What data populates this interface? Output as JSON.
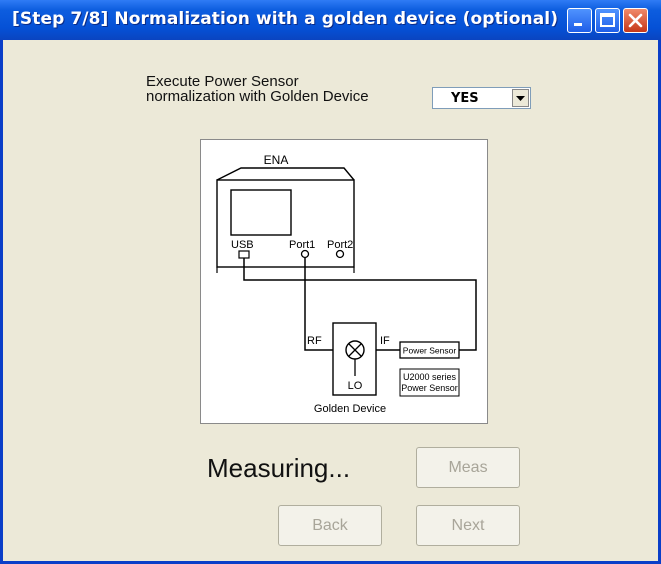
{
  "window": {
    "title": "[Step 7/8] Normalization with a golden device (optional)",
    "accent_color": "#0a44c0"
  },
  "normalization": {
    "label": "Execute Power Sensor\nnormalization with Golden Device",
    "selected_value": "YES"
  },
  "diagram": {
    "ena": "ENA",
    "usb": "USB",
    "port1": "Port1",
    "port2": "Port2",
    "rf": "RF",
    "if": "IF",
    "lo": "LO",
    "power_sensor": "Power Sensor",
    "sensor_series_line1": "U2000 series",
    "sensor_series_line2": "Power Sensor",
    "golden_device": "Golden Device"
  },
  "status": "Measuring...",
  "buttons": {
    "meas": "Meas",
    "back": "Back",
    "next": "Next"
  }
}
